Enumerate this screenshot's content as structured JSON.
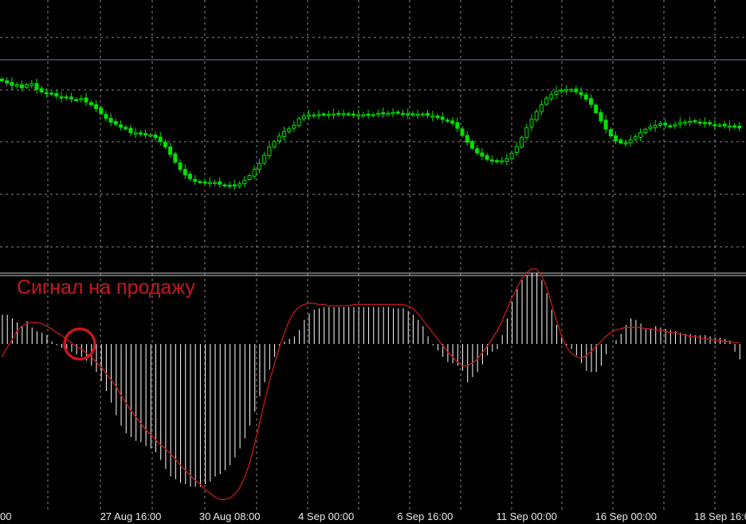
{
  "colors": {
    "background": "#000000",
    "grid": "#8a8a8a",
    "candle": "#00e200",
    "histogram": "#ffffff",
    "signal_line": "#c8171b",
    "axis_text": "#e8e8e8",
    "separator": "#c8c8c8",
    "level_line": "#6e78b4"
  },
  "annotation": {
    "text": "Сигнал на продажу",
    "marker": "red-circle"
  },
  "chart_data": [
    {
      "type": "candlestick",
      "title": "",
      "grid": true,
      "x_ticks": [
        "00",
        "27 Aug 16:00",
        "30 Aug 08:00",
        "4 Sep 00:00",
        "6 Sep 16:00",
        "11 Sep 00:00",
        "16 Sep 00:00",
        "18 Sep 16:00"
      ],
      "x_tick_bars": [
        0,
        20,
        40,
        60,
        80,
        100,
        120,
        140
      ],
      "candle_count": 150,
      "ylim": [
        0,
        100
      ],
      "close": [
        78.7,
        77.6,
        76.5,
        76.8,
        75.3,
        76.8,
        77.4,
        74.6,
        73.4,
        72.9,
        72.4,
        71.4,
        71.1,
        70.7,
        70.1,
        69.7,
        70.3,
        68.7,
        67.4,
        65.5,
        63.1,
        60.9,
        59.1,
        58.1,
        56.7,
        55.9,
        54.1,
        54.0,
        53.4,
        53.1,
        53.0,
        51.7,
        49.9,
        47.4,
        43.8,
        40.1,
        36.7,
        34.1,
        32.3,
        31.0,
        30.5,
        30.6,
        30.6,
        30.6,
        29.7,
        29.2,
        29.1,
        29.0,
        29.9,
        31.6,
        33.8,
        36.8,
        39.4,
        43.5,
        47.3,
        49.9,
        52.5,
        54.6,
        55.9,
        57.7,
        60.7,
        62.0,
        62.5,
        62.5,
        62.7,
        62.8,
        62.8,
        63.0,
        63.1,
        63.1,
        62.6,
        62.7,
        62.6,
        62.6,
        62.6,
        62.7,
        63.3,
        63.4,
        63.3,
        63.6,
        63.6,
        63.1,
        62.8,
        62.9,
        62.9,
        63.0,
        62.3,
        62.0,
        61.2,
        60.4,
        59.7,
        58.6,
        56.2,
        52.8,
        49.6,
        46.8,
        44.5,
        43.0,
        41.5,
        40.9,
        40.3,
        40.8,
        41.8,
        44.4,
        47.6,
        51.8,
        56.5,
        60.5,
        64.1,
        67.3,
        70.5,
        72.2,
        73.7,
        74.2,
        74.5,
        74.5,
        73.5,
        72.1,
        70.0,
        67.5,
        63.6,
        59.7,
        55.8,
        52.6,
        50.4,
        49.2,
        49.3,
        50.6,
        52.2,
        54.1,
        55.7,
        56.8,
        57.6,
        58.3,
        57.7,
        57.4,
        57.8,
        58.9,
        59.1,
        59.5,
        59.4,
        59.0,
        58.6,
        58.2,
        57.8,
        57.8,
        57.3,
        57.3,
        56.9,
        56.3
      ]
    },
    {
      "type": "bar",
      "title": "",
      "grid": true,
      "ylim": [
        -100,
        100
      ],
      "series": [
        {
          "type": "histogram",
          "values": [
            23,
            23,
            20,
            17,
            14,
            18,
            13,
            10,
            9,
            7,
            2,
            -1,
            -3,
            -5,
            -6,
            -8,
            -10,
            -13,
            -17,
            -22,
            -29,
            -37,
            -46,
            -56,
            -64,
            -70,
            -73,
            -76,
            -77,
            -80,
            -82,
            -85,
            -91,
            -98,
            -104,
            -106,
            -109,
            -110,
            -112,
            -112,
            -112,
            -110,
            -108,
            -104,
            -102,
            -99,
            -95,
            -89,
            -82,
            -74,
            -64,
            -53,
            -41,
            -30,
            -20,
            -10,
            -2,
            2,
            4,
            6,
            11,
            19,
            24,
            27,
            28,
            29,
            29,
            29,
            29,
            29,
            29,
            29,
            29,
            29,
            29,
            29,
            29,
            29,
            29,
            28,
            28,
            28,
            26,
            23,
            19,
            14,
            6,
            -1,
            -5,
            -10,
            -14,
            -15,
            -17,
            -21,
            -30,
            -26,
            -22,
            -16,
            -9,
            -6,
            -4,
            7,
            20,
            33,
            43,
            50,
            54,
            56,
            56,
            50,
            40,
            27,
            15,
            5,
            -1,
            -4,
            -9,
            -15,
            -21,
            -22,
            -22,
            -17,
            -8,
            0,
            3,
            8,
            15,
            20,
            19,
            16,
            12,
            12,
            14,
            13,
            12,
            11,
            10,
            9,
            8,
            8,
            7,
            7,
            7,
            6,
            5,
            5,
            4,
            3,
            -6,
            -12
          ]
        },
        {
          "type": "line",
          "values": [
            -10,
            -3,
            3,
            10,
            14,
            16,
            17,
            17,
            16,
            14,
            12,
            9,
            7,
            4,
            1,
            -2,
            -4,
            -7,
            -10,
            -14,
            -18,
            -23,
            -28,
            -33,
            -40,
            -46,
            -52,
            -57,
            -62,
            -67,
            -71,
            -75,
            -79,
            -82,
            -86,
            -90,
            -95,
            -99,
            -103,
            -107,
            -110,
            -114,
            -117,
            -120,
            -122,
            -122,
            -121,
            -118,
            -113,
            -105,
            -94,
            -79,
            -63,
            -46,
            -30,
            -16,
            -3,
            8,
            18,
            25,
            29,
            31,
            32,
            32,
            31,
            31,
            30,
            30,
            30,
            30,
            30,
            31,
            31,
            31,
            31,
            31,
            31,
            31,
            31,
            31,
            31,
            31,
            30,
            28,
            24,
            19,
            14,
            9,
            4,
            -1,
            -6,
            -10,
            -14,
            -17,
            -17,
            -15,
            -12,
            -7,
            -2,
            4,
            10,
            18,
            27,
            36,
            44,
            51,
            56,
            59,
            59,
            54,
            45,
            32,
            19,
            7,
            -2,
            -7,
            -10,
            -11,
            -9,
            -6,
            -2,
            2,
            6,
            9,
            11,
            12,
            13,
            13,
            13,
            13,
            12,
            12,
            11,
            11,
            10,
            9,
            9,
            8,
            7,
            6,
            6,
            5,
            4,
            4,
            3,
            3,
            2,
            2,
            1,
            1
          ]
        }
      ]
    }
  ]
}
